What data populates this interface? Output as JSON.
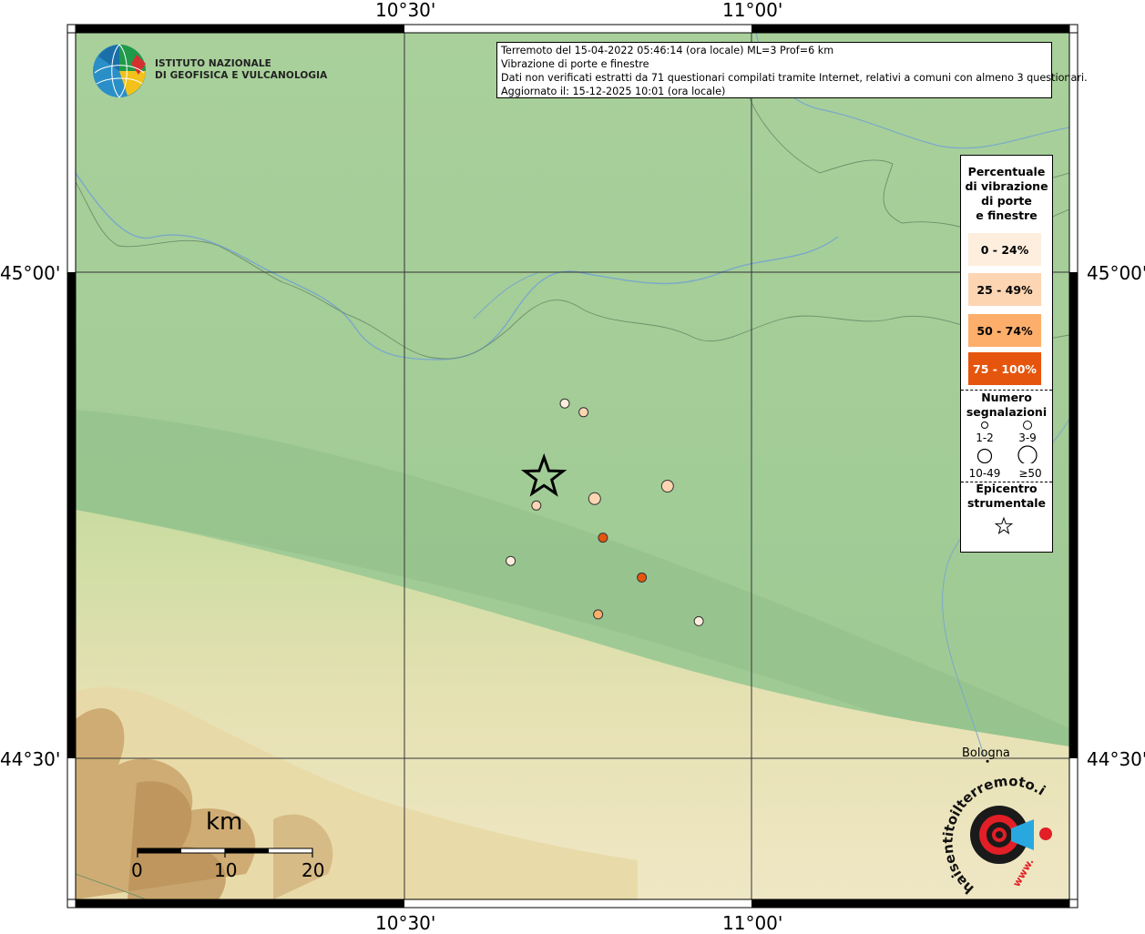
{
  "frame": {
    "top_labels": [
      "10°30'",
      "11°00'"
    ],
    "bottom_labels": [
      "10°30'",
      "11°00'"
    ],
    "left_labels": [
      "45°00'",
      "44°30'"
    ],
    "right_labels": [
      "45°00'",
      "44°30'"
    ]
  },
  "institute": {
    "line1": "ISTITUTO NAZIONALE",
    "line2": "DI GEOFISICA E VULCANOLOGIA"
  },
  "info": {
    "line1": "Terremoto del 15-04-2022 05:46:14 (ora locale) ML=3 Prof=6 km",
    "line2": "Vibrazione di porte e finestre",
    "line3": "Dati non verificati estratti da 71 questionari compilati tramite Internet, relativi a comuni con almeno 3 questionari.",
    "line4": "Aggiornato il: 15-12-2025 10:01 (ora locale)"
  },
  "legend": {
    "title_lines": [
      "Percentuale",
      "di vibrazione",
      "di porte",
      "e finestre"
    ],
    "classes": [
      {
        "label": "0 - 24%",
        "color": "#fdeedd",
        "text_color": "#000000"
      },
      {
        "label": "25 - 49%",
        "color": "#fdd5b3",
        "text_color": "#000000"
      },
      {
        "label": "50 - 74%",
        "color": "#fdae6b",
        "text_color": "#000000"
      },
      {
        "label": "75 - 100%",
        "color": "#e6550d",
        "text_color": "#ffffff"
      }
    ],
    "count_title_lines": [
      "Numero",
      "segnalazioni"
    ],
    "count_classes": [
      "1-2",
      "3-9",
      "10-49",
      "≥50"
    ],
    "epicenter_lines": [
      "Epicentro",
      "strumentale"
    ]
  },
  "observations": [
    {
      "lon": 10.731,
      "lat": 44.865,
      "class": 0,
      "size": 0
    },
    {
      "lon": 10.758,
      "lat": 44.856,
      "class": 1,
      "size": 0
    },
    {
      "lon": 10.774,
      "lat": 44.767,
      "class": 1,
      "size": 1
    },
    {
      "lon": 10.879,
      "lat": 44.78,
      "class": 1,
      "size": 1
    },
    {
      "lon": 10.69,
      "lat": 44.76,
      "class": 1,
      "size": 0
    },
    {
      "lon": 10.786,
      "lat": 44.727,
      "class": 3,
      "size": 0
    },
    {
      "lon": 10.653,
      "lat": 44.703,
      "class": 0,
      "size": 0
    },
    {
      "lon": 10.842,
      "lat": 44.686,
      "class": 3,
      "size": 0
    },
    {
      "lon": 10.779,
      "lat": 44.648,
      "class": 2,
      "size": 0
    },
    {
      "lon": 10.924,
      "lat": 44.641,
      "class": 0,
      "size": 0
    }
  ],
  "epicenter": {
    "lon": 10.701,
    "lat": 44.789
  },
  "city": {
    "name": "Bologna",
    "lon": 11.34,
    "lat": 44.497
  },
  "scale": {
    "title": "km",
    "labels": [
      "0",
      "10",
      "20"
    ]
  },
  "badge": {
    "text": "haisentitoilterremoto.it",
    "prefix": "www."
  },
  "colors": {
    "land": "#9fca94",
    "river": "#7aa9c9",
    "border": "#6f8f6a",
    "hill": "#e7e0b0",
    "mountain": "#c9a36a"
  }
}
